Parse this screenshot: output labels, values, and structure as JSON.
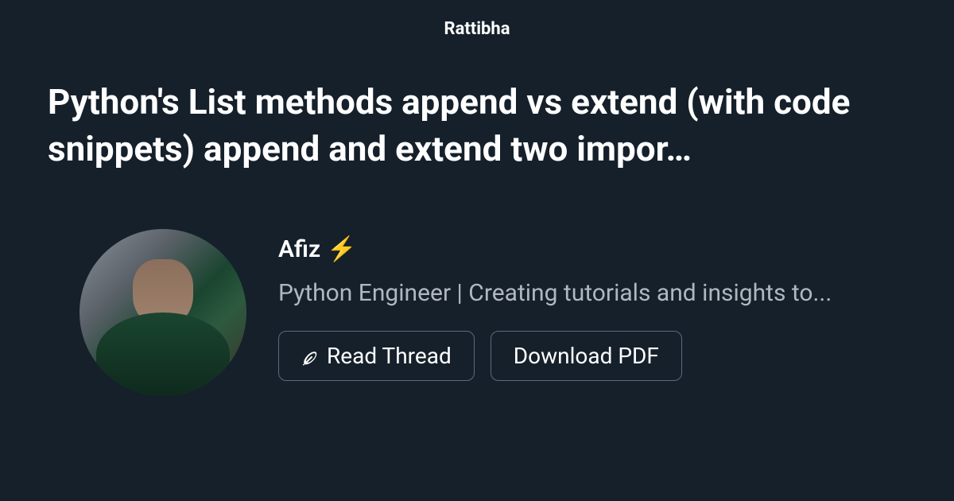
{
  "site": {
    "name": "Rattibha"
  },
  "thread": {
    "title": "Python's List methods append vs extend (with code snippets) append and extend two impor…"
  },
  "author": {
    "name": "Afiz",
    "emoji": "⚡",
    "bio": "Python Engineer | Creating tutorials and insights to..."
  },
  "buttons": {
    "read_thread": "Read Thread",
    "download_pdf": "Download PDF"
  }
}
